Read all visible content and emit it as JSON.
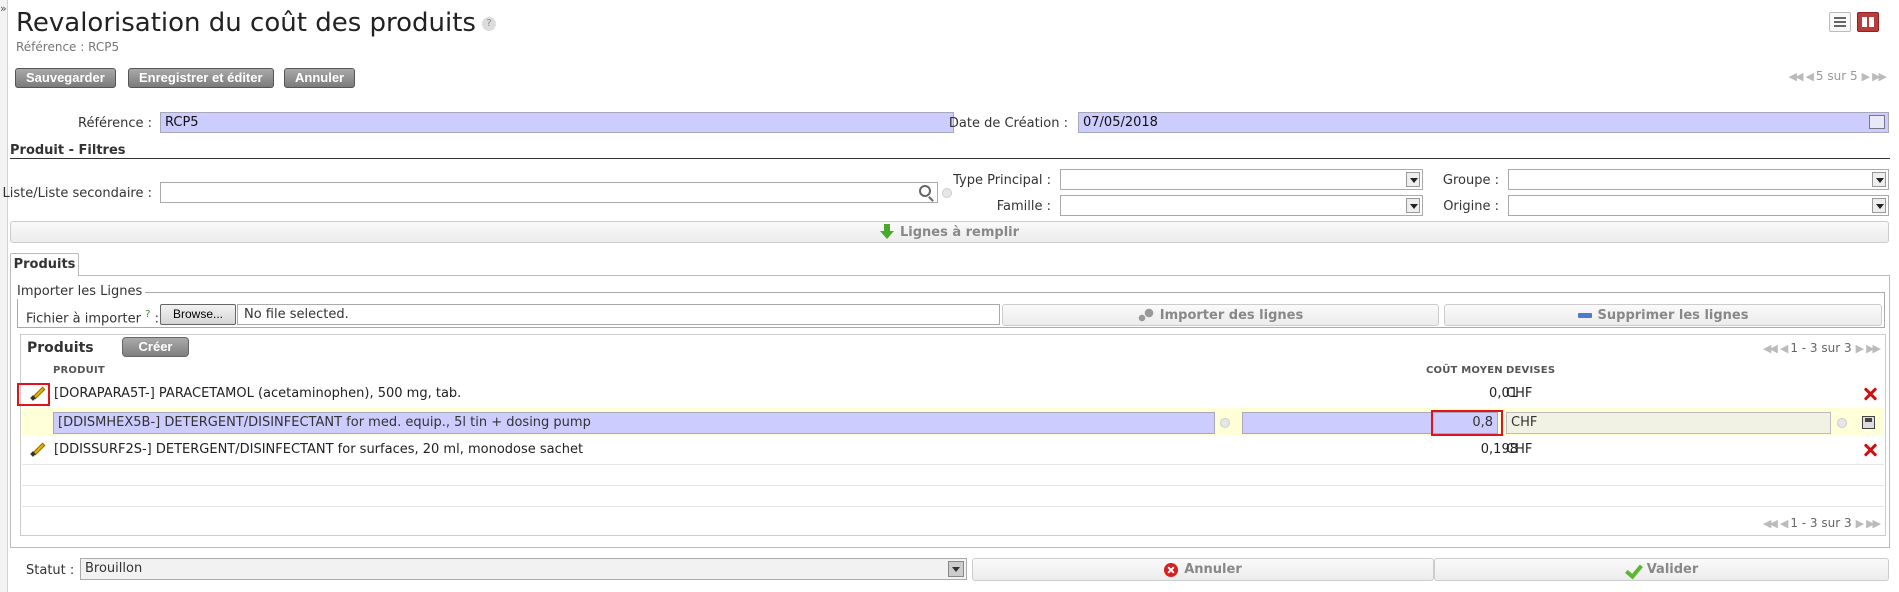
{
  "header": {
    "title": "Revalorisation du coût des produits",
    "help": "?",
    "subtitle": "Référence : RCP5"
  },
  "toolbar": {
    "save": "Sauvegarder",
    "save_edit": "Enregistrer et éditer",
    "cancel": "Annuler",
    "pager": "5 sur 5"
  },
  "form": {
    "ref_label": "Référence :",
    "ref_value": "RCP5",
    "date_label": "Date de Création :",
    "date_value": "07/05/2018"
  },
  "filters": {
    "title": "Produit - Filtres",
    "list_label": "Liste/Liste secondaire :",
    "type_label": "Type Principal :",
    "famille_label": "Famille :",
    "groupe_label": "Groupe :",
    "origine_label": "Origine :",
    "fill_lines": "Lignes à remplir"
  },
  "tabs": {
    "produits": "Produits"
  },
  "import": {
    "legend": "Importer les Lignes",
    "file_label": "Fichier à importer",
    "help": "?",
    "colon": ":",
    "browse": "Browse...",
    "no_file": "No file selected.",
    "import_btn": "Importer des lignes",
    "delete_btn": "Supprimer les lignes"
  },
  "products": {
    "title": "Produits",
    "create": "Créer",
    "pager": "1 - 3 sur 3",
    "columns": {
      "produit": "PRODUIT",
      "cout": "COÛT MOYEN",
      "devises": "DEVISES"
    },
    "rows": [
      {
        "produit": "[DORAPARA5T-] PARACETAMOL (acetaminophen), 500 mg, tab.",
        "cout": "0,01",
        "devise": "CHF"
      },
      {
        "produit": "[DDISMHEX5B-] DETERGENT/DISINFECTANT for med. equip., 5l tin + dosing pump",
        "cout": "0,8",
        "devise": "CHF"
      },
      {
        "produit": "[DDISSURF2S-] DETERGENT/DISINFECTANT for surfaces, 20 ml, monodose sachet",
        "cout": "0,198",
        "devise": "CHF"
      }
    ]
  },
  "footer": {
    "status_label": "Statut :",
    "status_value": "Brouillon",
    "cancel": "Annuler",
    "validate": "Valider"
  },
  "colors": {
    "input_bg": "#ccccff",
    "button_grey": "#8c8c8c",
    "highlight_red": "#e0141e",
    "edit_row_bg": "#ffffd8",
    "validate_green": "#5cb830"
  }
}
